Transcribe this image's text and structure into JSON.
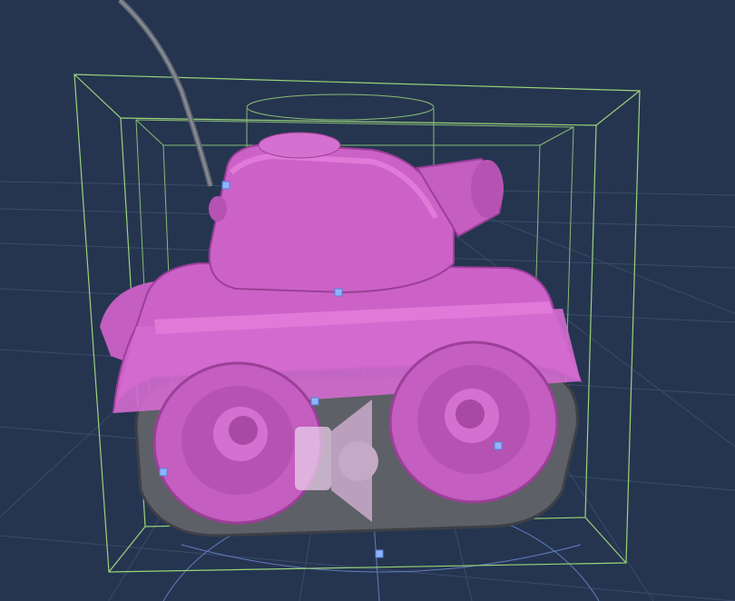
{
  "viewport": {
    "background": "#253550",
    "grid_color": "#3a4c6a",
    "bounds_color": "#9ad37a",
    "handle_color": "#8fb4ff",
    "gizmo_color": "#6f8fd8"
  },
  "model": {
    "name_icon": "tank-model",
    "body_color": "#cc62c8",
    "body_highlight": "#e07ad9",
    "body_shadow": "#9c3f98",
    "track_color": "#5d6066"
  },
  "selection": {
    "handle_icons": [
      "resize-handle",
      "resize-handle",
      "resize-handle",
      "resize-handle",
      "resize-handle",
      "resize-handle"
    ]
  },
  "gizmos": {
    "emitter_icon": "audio-emitter-icon"
  }
}
